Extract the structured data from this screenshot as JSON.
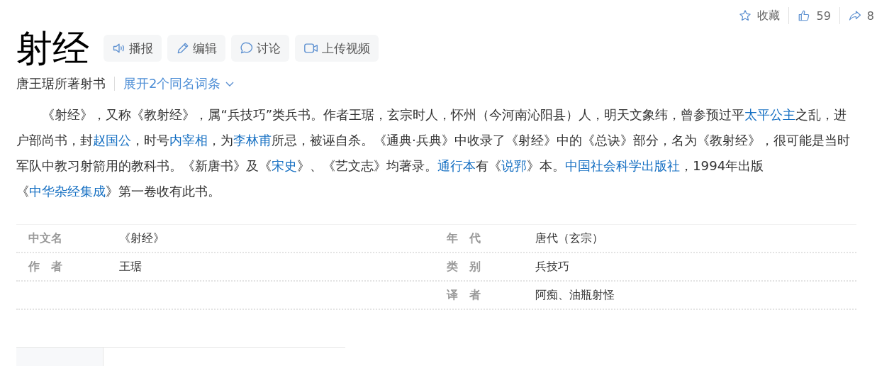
{
  "top_actions": {
    "favorite": "收藏",
    "likes": "59",
    "shares": "8"
  },
  "title": "射经",
  "tools": [
    {
      "kind": "speaker",
      "label": "播报"
    },
    {
      "kind": "pencil",
      "label": "编辑"
    },
    {
      "kind": "bubble",
      "label": "讨论"
    },
    {
      "kind": "video",
      "label": "上传视频"
    }
  ],
  "subtitle": "唐王琚所著射书",
  "expand_link": "展开2个同名词条",
  "summary": [
    {
      "kind": "text",
      "text": "《射经》，又称《教射经》，属“兵技巧”类兵书。作者王琚，玄宗时人，怀州（今河南沁阳县）人，明天文象纬，曾参预过平"
    },
    {
      "kind": "link",
      "text": "太平公主"
    },
    {
      "kind": "text",
      "text": "之乱，进户部尚书，封"
    },
    {
      "kind": "link",
      "text": "赵国公"
    },
    {
      "kind": "text",
      "text": "，时号"
    },
    {
      "kind": "link",
      "text": "内宰相"
    },
    {
      "kind": "text",
      "text": "，为"
    },
    {
      "kind": "link",
      "text": "李林甫"
    },
    {
      "kind": "text",
      "text": "所忌，被诬自杀。《通典·兵典》中收录了《射经》中的《总诀》部分，名为《教射经》，很可能是当时军队中教习射箭用的教科书。《新唐书》及《"
    },
    {
      "kind": "link",
      "text": "宋史"
    },
    {
      "kind": "text",
      "text": "》、《艺文志》均著录。"
    },
    {
      "kind": "link",
      "text": "通行本"
    },
    {
      "kind": "text",
      "text": "有《"
    },
    {
      "kind": "link",
      "text": "说郛"
    },
    {
      "kind": "text",
      "text": "》本。"
    },
    {
      "kind": "link",
      "text": "中国社会科学出版社"
    },
    {
      "kind": "text",
      "text": "，1994年出版《"
    },
    {
      "kind": "link",
      "text": "中华杂经集成"
    },
    {
      "kind": "text",
      "text": "》第一卷收有此书。"
    }
  ],
  "basic_info": [
    {
      "left_label": "中文名",
      "left_value": "《射经》",
      "right_label": "年代",
      "right_value": "唐代（玄宗）"
    },
    {
      "left_label": "作者",
      "left_value": "王琚",
      "right_label": "类别",
      "right_value": "兵技巧"
    },
    {
      "right_label": "译者",
      "right_value": "阿痴、油瓶射怪"
    }
  ]
}
